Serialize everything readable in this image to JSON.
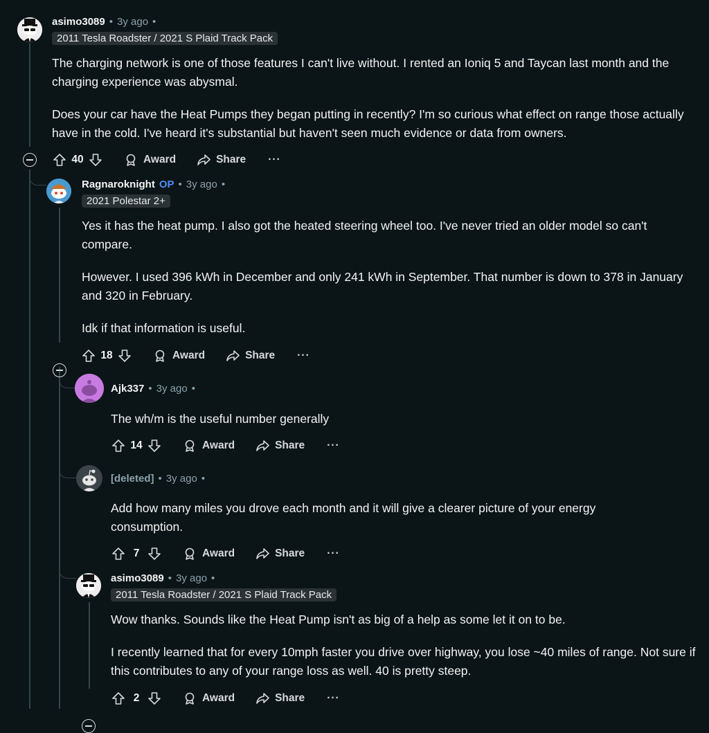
{
  "colors": {
    "background": "#0b1416",
    "text": "#f2f4f5",
    "meta": "#8ba2ad",
    "op_badge": "#4d8df7",
    "flair_bg": "#2a3236"
  },
  "comments": [
    {
      "username": "asimo3089",
      "age": "3y ago",
      "flair": "2011 Tesla Roadster / 2021 S Plaid Track Pack",
      "avatar_icon": "snoo-tuxedo-avatar",
      "paragraphs": [
        "The charging network is one of those features I can't live without. I rented an Ioniq 5 and Taycan last month and the charging experience was abysmal.",
        "Does your car have the Heat Pumps they began putting in recently? I'm so curious what effect on range those actually have in the cold. I've heard it's substantial but haven't seen much evidence or data from owners."
      ],
      "votes": "40",
      "award_label": "Award",
      "share_label": "Share",
      "more_label": "···"
    },
    {
      "username": "Ragnaroknight",
      "op_label": "OP",
      "age": "3y ago",
      "flair": "2021 Polestar 2+",
      "avatar_icon": "snoo-hat-avatar",
      "paragraphs": [
        "Yes it has the heat pump. I also got the heated steering wheel too. I've never tried an older model so can't compare.",
        "However. I used 396 kWh in December and only 241 kWh in September. That number is down to 378 in January and 320 in February.",
        "Idk if that information is useful."
      ],
      "votes": "18",
      "award_label": "Award",
      "share_label": "Share",
      "more_label": "···"
    },
    {
      "username": "Ajk337",
      "age": "3y ago",
      "avatar_icon": "default-snoo-avatar",
      "paragraphs": [
        "The wh/m is the useful number generally"
      ],
      "votes": "14",
      "award_label": "Award",
      "share_label": "Share",
      "more_label": "···"
    },
    {
      "username": "[deleted]",
      "age": "3y ago",
      "avatar_icon": "deleted-snoo-avatar",
      "paragraphs": [
        "Add how many miles you drove each month and it will give a clearer picture of your energy consumption."
      ],
      "votes": "7",
      "award_label": "Award",
      "share_label": "Share",
      "more_label": "···"
    },
    {
      "username": "asimo3089",
      "age": "3y ago",
      "flair": "2011 Tesla Roadster / 2021 S Plaid Track Pack",
      "avatar_icon": "snoo-tuxedo-avatar",
      "paragraphs": [
        "Wow thanks. Sounds like the Heat Pump isn't as big of a help as some let it on to be.",
        "I recently learned that for every 10mph faster you drive over highway, you lose ~40 miles of range. Not sure if this contributes to any of your range loss as well. 40 is pretty steep."
      ],
      "votes": "2",
      "award_label": "Award",
      "share_label": "Share",
      "more_label": "···"
    }
  ],
  "separator": "•"
}
